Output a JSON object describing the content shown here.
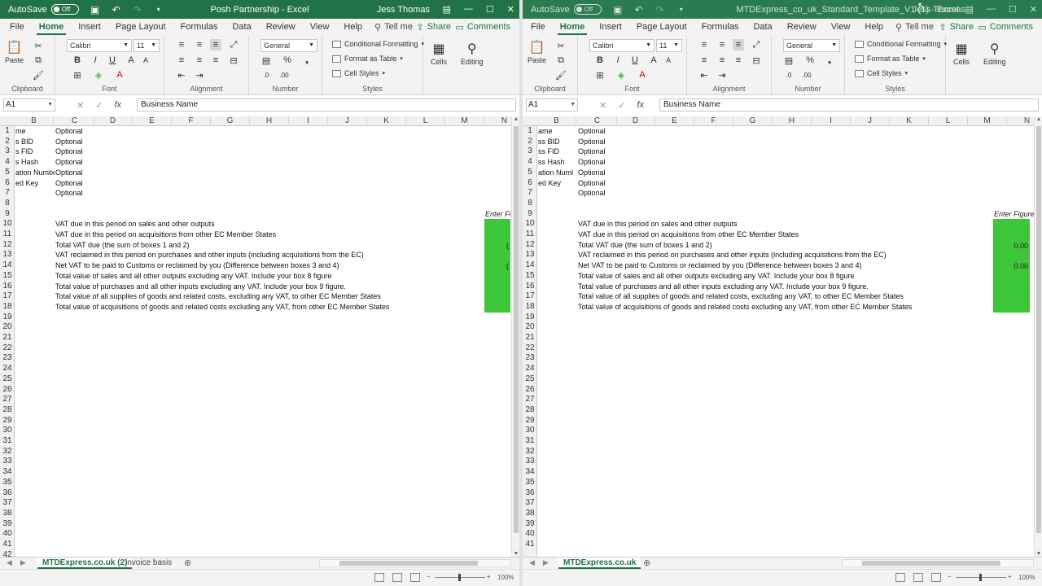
{
  "left": {
    "autosave_label": "AutoSave",
    "autosave_state": "Off",
    "title": "Posh Partnership  -  Excel",
    "user": "Jess Thomas",
    "menus": [
      "File",
      "Home",
      "Insert",
      "Page Layout",
      "Formulas",
      "Data",
      "Review",
      "View",
      "Help"
    ],
    "tell_me": "Tell me",
    "share": "Share",
    "comments": "Comments",
    "ribbon": {
      "paste": "Paste",
      "clipboard": "Clipboard",
      "font_name": "Calibri",
      "font_size": "11",
      "font": "Font",
      "alignment": "Alignment",
      "number_format": "General",
      "number": "Number",
      "conditional_formatting": "Conditional Formatting",
      "format_as_table": "Format as Table",
      "cell_styles": "Cell Styles",
      "styles": "Styles",
      "cells": "Cells",
      "editing": "Editing"
    },
    "namebox": "A1",
    "formula": "Business Name",
    "columns": [
      "B",
      "C",
      "D",
      "E",
      "F",
      "G",
      "H",
      "I",
      "J",
      "K",
      "L",
      "M",
      "N"
    ],
    "rows": [
      "1",
      "2",
      "3",
      "4",
      "5",
      "6",
      "7",
      "8",
      "9",
      "10",
      "11",
      "12",
      "13",
      "14",
      "15",
      "16",
      "17",
      "18",
      "19",
      "20",
      "21",
      "22",
      "23",
      "24",
      "25",
      "26",
      "27",
      "28",
      "29",
      "30",
      "31",
      "32",
      "33",
      "34",
      "35",
      "36",
      "37",
      "38",
      "39",
      "40",
      "41",
      "42"
    ],
    "col_b": [
      "me",
      "s BID",
      "s FID",
      "s Hash",
      "ation Numbe",
      "ed Key"
    ],
    "col_c_optional": [
      "Optional",
      "Optional",
      "Optional",
      "Optional",
      "Optional",
      "Optional",
      "Optional"
    ],
    "enter_figures": "Enter Fi",
    "vat_lines": [
      "VAT due in this period on sales and other outputs",
      "VAT due in this period on acquisitions from other EC Member States",
      "Total VAT due (the sum of boxes 1 and 2)",
      "VAT reclaimed in this period on purchases and other inputs (including acquisitions from the EC)",
      "Net VAT to be paid to Customs or reclaimed by you (Difference between boxes 3 and 4)",
      "Total value of sales and all other outputs excluding any VAT. Include your box 8 figure",
      "Total value of purchases and all other inputs excluding any VAT. Include your box 9 figure.",
      "Total value of all supplies of goods and related costs, excluding any VAT, to other EC Member States",
      "Total value of acquisitions of goods and related costs excluding any VAT, from other EC Member States"
    ],
    "partial_values": [
      "(",
      "("
    ],
    "sheets": [
      "MTDExpress.co.uk (2)",
      "invoice basis"
    ],
    "zoom": "100%"
  },
  "right": {
    "autosave_label": "AutoSave",
    "autosave_state": "Off",
    "title": "MTDExpress_co_uk_Standard_Template_V1 (1)  -  Excel",
    "user": "Jess Thomas",
    "menus": [
      "File",
      "Home",
      "Insert",
      "Page Layout",
      "Formulas",
      "Data",
      "Review",
      "View",
      "Help"
    ],
    "tell_me": "Tell me",
    "share": "Share",
    "comments": "Comments",
    "ribbon": {
      "paste": "Paste",
      "clipboard": "Clipboard",
      "font_name": "Calibri",
      "font_size": "11",
      "font": "Font",
      "alignment": "Alignment",
      "number_format": "General",
      "number": "Number",
      "conditional_formatting": "Conditional Formatting",
      "format_as_table": "Format as Table",
      "cell_styles": "Cell Styles",
      "styles": "Styles",
      "cells": "Cells",
      "editing": "Editing"
    },
    "namebox": "A1",
    "formula": "Business Name",
    "columns": [
      "B",
      "C",
      "D",
      "E",
      "F",
      "G",
      "H",
      "I",
      "J",
      "K",
      "L",
      "M",
      "N"
    ],
    "rows": [
      "1",
      "2",
      "3",
      "4",
      "5",
      "6",
      "7",
      "8",
      "9",
      "10",
      "11",
      "12",
      "13",
      "14",
      "15",
      "16",
      "17",
      "18",
      "19",
      "20",
      "21",
      "22",
      "23",
      "24",
      "25",
      "26",
      "27",
      "28",
      "29",
      "30",
      "31",
      "32",
      "33",
      "34",
      "35",
      "36",
      "37",
      "38",
      "39",
      "40",
      "41"
    ],
    "col_b": [
      "ame",
      "ss BID",
      "ss FID",
      "ss Hash",
      "ation Numl",
      "ed Key"
    ],
    "col_c_optional": [
      "Optional",
      "Optional",
      "Optional",
      "Optional",
      "Optional",
      "Optional",
      "Optional"
    ],
    "enter_figures": "Enter Figures:-",
    "vat_lines": [
      "VAT due in this period on sales and other outputs",
      "VAT due in this period on acquisitions from other EC Member States",
      "Total VAT due (the sum of boxes 1 and 2)",
      "VAT reclaimed in this period on purchases and other inputs (including acquisitions from the EC)",
      "Net VAT to be paid to Customs or reclaimed by you (Difference between boxes 3 and 4)",
      "Total value of sales and all other outputs excluding any VAT. Include your box 8 figure",
      "Total value of purchases and all other inputs excluding any VAT. Include your box 9 figure.",
      "Total value of all supplies of goods and related costs, excluding any VAT, to other EC Member States",
      "Total value of acquisitions of goods and related costs excluding any VAT, from other EC Member States"
    ],
    "values": [
      "0.00",
      "0.00"
    ],
    "sheets": [
      "MTDExpress.co.uk"
    ],
    "zoom": "100%"
  },
  "colors": {
    "excel_green": "#217346",
    "cell_green": "#3ec63a"
  }
}
